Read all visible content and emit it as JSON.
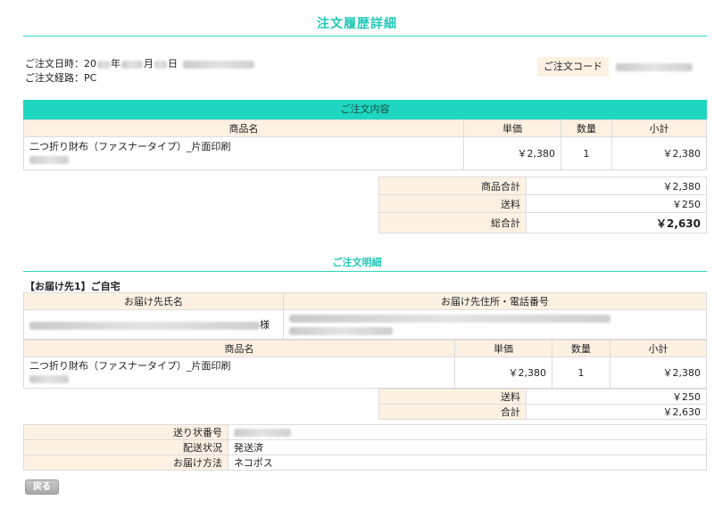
{
  "page": {
    "title": "注文履歴詳細"
  },
  "meta": {
    "date_label": "ご注文日時：20",
    "date_year": "年",
    "date_month": "月",
    "date_day": "日",
    "route": "ご注文経路：PC",
    "order_code_label": "ご注文コード"
  },
  "order_section": {
    "title": "ご注文内容",
    "headers": {
      "name": "商品名",
      "price": "単価",
      "qty": "数量",
      "subtotal": "小計"
    },
    "item": {
      "name": "二つ折り財布（ファスナータイプ）_片面印刷",
      "price": "￥2,380",
      "qty": "1",
      "subtotal": "￥2,380"
    },
    "totals": {
      "goods_label": "商品合計",
      "goods": "￥2,380",
      "shipping_label": "送料",
      "shipping": "￥250",
      "grand_label": "総合計",
      "grand": "￥2,630"
    }
  },
  "detail_section": {
    "title": "ご注文明細",
    "destination_label": "【お届け先1】ご自宅",
    "dest_headers": {
      "name": "お届け先氏名",
      "address": "お届け先住所・電話番号"
    },
    "honorific": "様",
    "headers": {
      "name": "商品名",
      "price": "単価",
      "qty": "数量",
      "subtotal": "小計"
    },
    "item": {
      "name": "二つ折り財布（ファスナータイプ）_片面印刷",
      "price": "￥2,380",
      "qty": "1",
      "subtotal": "￥2,380"
    },
    "totals": {
      "shipping_label": "送料",
      "shipping": "￥250",
      "total_label": "合計",
      "total": "￥2,630"
    },
    "shipping": {
      "tracking_label": "送り状番号",
      "status_label": "配送状況",
      "status": "発送済",
      "method_label": "お届け方法",
      "method": "ネコポス"
    }
  },
  "actions": {
    "back_label": "戻る"
  },
  "colors": {
    "accent": "#1fd6c0",
    "label_bg": "#fdf1e3"
  }
}
